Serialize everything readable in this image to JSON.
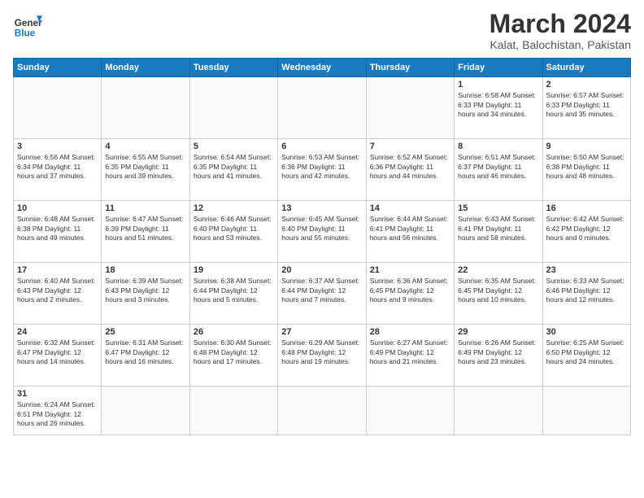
{
  "header": {
    "logo_general": "General",
    "logo_blue": "Blue",
    "title": "March 2024",
    "subtitle": "Kalat, Balochistan, Pakistan"
  },
  "days_of_week": [
    "Sunday",
    "Monday",
    "Tuesday",
    "Wednesday",
    "Thursday",
    "Friday",
    "Saturday"
  ],
  "weeks": [
    [
      {
        "day": "",
        "info": ""
      },
      {
        "day": "",
        "info": ""
      },
      {
        "day": "",
        "info": ""
      },
      {
        "day": "",
        "info": ""
      },
      {
        "day": "",
        "info": ""
      },
      {
        "day": "1",
        "info": "Sunrise: 6:58 AM\nSunset: 6:33 PM\nDaylight: 11 hours\nand 34 minutes."
      },
      {
        "day": "2",
        "info": "Sunrise: 6:57 AM\nSunset: 6:33 PM\nDaylight: 11 hours\nand 35 minutes."
      }
    ],
    [
      {
        "day": "3",
        "info": "Sunrise: 6:56 AM\nSunset: 6:34 PM\nDaylight: 11 hours\nand 37 minutes."
      },
      {
        "day": "4",
        "info": "Sunrise: 6:55 AM\nSunset: 6:35 PM\nDaylight: 11 hours\nand 39 minutes."
      },
      {
        "day": "5",
        "info": "Sunrise: 6:54 AM\nSunset: 6:35 PM\nDaylight: 11 hours\nand 41 minutes."
      },
      {
        "day": "6",
        "info": "Sunrise: 6:53 AM\nSunset: 6:36 PM\nDaylight: 11 hours\nand 42 minutes."
      },
      {
        "day": "7",
        "info": "Sunrise: 6:52 AM\nSunset: 6:36 PM\nDaylight: 11 hours\nand 44 minutes."
      },
      {
        "day": "8",
        "info": "Sunrise: 6:51 AM\nSunset: 6:37 PM\nDaylight: 11 hours\nand 46 minutes."
      },
      {
        "day": "9",
        "info": "Sunrise: 6:50 AM\nSunset: 6:38 PM\nDaylight: 11 hours\nand 48 minutes."
      }
    ],
    [
      {
        "day": "10",
        "info": "Sunrise: 6:48 AM\nSunset: 6:38 PM\nDaylight: 11 hours\nand 49 minutes."
      },
      {
        "day": "11",
        "info": "Sunrise: 6:47 AM\nSunset: 6:39 PM\nDaylight: 11 hours\nand 51 minutes."
      },
      {
        "day": "12",
        "info": "Sunrise: 6:46 AM\nSunset: 6:40 PM\nDaylight: 11 hours\nand 53 minutes."
      },
      {
        "day": "13",
        "info": "Sunrise: 6:45 AM\nSunset: 6:40 PM\nDaylight: 11 hours\nand 55 minutes."
      },
      {
        "day": "14",
        "info": "Sunrise: 6:44 AM\nSunset: 6:41 PM\nDaylight: 11 hours\nand 56 minutes."
      },
      {
        "day": "15",
        "info": "Sunrise: 6:43 AM\nSunset: 6:41 PM\nDaylight: 11 hours\nand 58 minutes."
      },
      {
        "day": "16",
        "info": "Sunrise: 6:42 AM\nSunset: 6:42 PM\nDaylight: 12 hours\nand 0 minutes."
      }
    ],
    [
      {
        "day": "17",
        "info": "Sunrise: 6:40 AM\nSunset: 6:43 PM\nDaylight: 12 hours\nand 2 minutes."
      },
      {
        "day": "18",
        "info": "Sunrise: 6:39 AM\nSunset: 6:43 PM\nDaylight: 12 hours\nand 3 minutes."
      },
      {
        "day": "19",
        "info": "Sunrise: 6:38 AM\nSunset: 6:44 PM\nDaylight: 12 hours\nand 5 minutes."
      },
      {
        "day": "20",
        "info": "Sunrise: 6:37 AM\nSunset: 6:44 PM\nDaylight: 12 hours\nand 7 minutes."
      },
      {
        "day": "21",
        "info": "Sunrise: 6:36 AM\nSunset: 6:45 PM\nDaylight: 12 hours\nand 9 minutes."
      },
      {
        "day": "22",
        "info": "Sunrise: 6:35 AM\nSunset: 6:45 PM\nDaylight: 12 hours\nand 10 minutes."
      },
      {
        "day": "23",
        "info": "Sunrise: 6:33 AM\nSunset: 6:46 PM\nDaylight: 12 hours\nand 12 minutes."
      }
    ],
    [
      {
        "day": "24",
        "info": "Sunrise: 6:32 AM\nSunset: 6:47 PM\nDaylight: 12 hours\nand 14 minutes."
      },
      {
        "day": "25",
        "info": "Sunrise: 6:31 AM\nSunset: 6:47 PM\nDaylight: 12 hours\nand 16 minutes."
      },
      {
        "day": "26",
        "info": "Sunrise: 6:30 AM\nSunset: 6:48 PM\nDaylight: 12 hours\nand 17 minutes."
      },
      {
        "day": "27",
        "info": "Sunrise: 6:29 AM\nSunset: 6:48 PM\nDaylight: 12 hours\nand 19 minutes."
      },
      {
        "day": "28",
        "info": "Sunrise: 6:27 AM\nSunset: 6:49 PM\nDaylight: 12 hours\nand 21 minutes."
      },
      {
        "day": "29",
        "info": "Sunrise: 6:26 AM\nSunset: 6:49 PM\nDaylight: 12 hours\nand 23 minutes."
      },
      {
        "day": "30",
        "info": "Sunrise: 6:25 AM\nSunset: 6:50 PM\nDaylight: 12 hours\nand 24 minutes."
      }
    ],
    [
      {
        "day": "31",
        "info": "Sunrise: 6:24 AM\nSunset: 6:51 PM\nDaylight: 12 hours\nand 26 minutes."
      },
      {
        "day": "",
        "info": ""
      },
      {
        "day": "",
        "info": ""
      },
      {
        "day": "",
        "info": ""
      },
      {
        "day": "",
        "info": ""
      },
      {
        "day": "",
        "info": ""
      },
      {
        "day": "",
        "info": ""
      }
    ]
  ]
}
